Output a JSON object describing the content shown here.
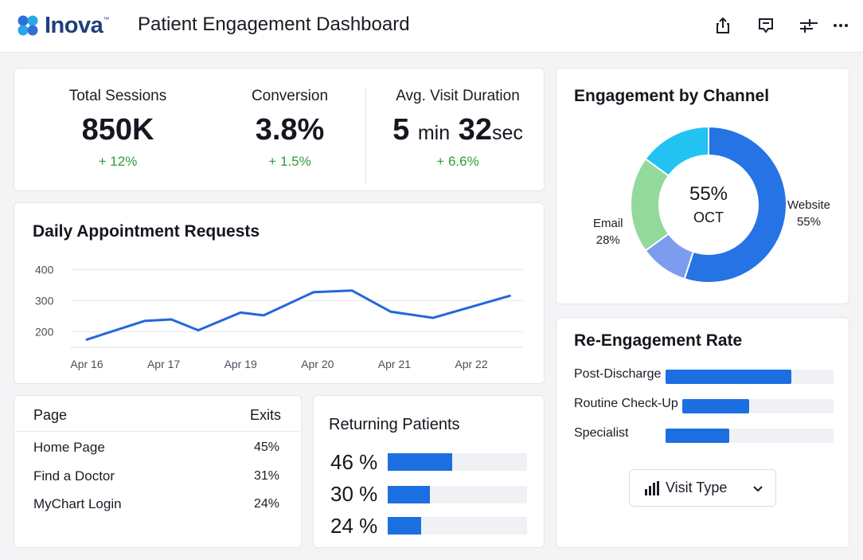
{
  "header": {
    "logo_text": "Inova",
    "logo_tm": "™",
    "title": "Patient Engagement Dashboard",
    "icons": [
      "share-icon",
      "comment-icon",
      "filter-settings-icon",
      "more-icon"
    ]
  },
  "kpis": {
    "sessions": {
      "label": "Total Sessions",
      "value": "850K",
      "delta": "+ 12%"
    },
    "conversion": {
      "label": "Conversion",
      "value": "3.8%",
      "delta": "+ 1.5%"
    },
    "duration": {
      "label": "Avg. Visit Duration",
      "min": "5",
      "min_unit": "min",
      "sec": "32",
      "sec_unit": "sec",
      "delta": "+ 6.6%"
    }
  },
  "channel": {
    "title": "Engagement by Channel",
    "center_value": "55%",
    "center_label": "OCT",
    "labels": {
      "website": {
        "name": "Website",
        "pct": "55%"
      },
      "email": {
        "name": "Email",
        "pct": "28%"
      }
    }
  },
  "daily": {
    "title": "Daily Appointment Requests"
  },
  "exits_table": {
    "headers": [
      "Page",
      "Exits"
    ],
    "rows": [
      {
        "page": "Home Page",
        "exits": "45%"
      },
      {
        "page": "Find a Doctor",
        "exits": "31%"
      },
      {
        "page": "MyChart Login",
        "exits": "24%"
      }
    ]
  },
  "returning": {
    "title": "Returning Patients",
    "rows": [
      {
        "label": "46 %",
        "value": 0.46
      },
      {
        "label": "30 %",
        "value": 0.3
      },
      {
        "label": "24 %",
        "value": 0.24
      }
    ]
  },
  "reengagement": {
    "title": "Re-Engagement Rate",
    "rows": [
      {
        "label": "Post-Discharge",
        "value": 0.75
      },
      {
        "label": "Routine Check-Up",
        "value": 0.44
      },
      {
        "label": "Specialist",
        "value": 0.38
      }
    ],
    "dropdown_label": "Visit Type"
  },
  "colors": {
    "accent": "#1c6fe0",
    "positive": "#2d9d3a",
    "brand": "#1f3e7c",
    "website": "#2673e6",
    "mobile": "#7c9cef",
    "email": "#92d99b",
    "other": "#22c2f2"
  },
  "chart_data": [
    {
      "type": "line",
      "title": "Daily Appointment Requests",
      "x_ticks": [
        "Apr 16",
        "Apr 17",
        "Apr 19",
        "Apr 20",
        "Apr 21",
        "Apr 22"
      ],
      "y_ticks": [
        "200",
        "300",
        "400"
      ],
      "ylim": [
        150,
        430
      ],
      "grid": true,
      "series": [
        {
          "values": [
            {
              "x": 0.0,
              "y": 175
            },
            {
              "x": 0.75,
              "y": 235
            },
            {
              "x": 1.1,
              "y": 240
            },
            {
              "x": 1.45,
              "y": 205
            },
            {
              "x": 2.0,
              "y": 262
            },
            {
              "x": 2.3,
              "y": 253
            },
            {
              "x": 2.95,
              "y": 328
            },
            {
              "x": 3.45,
              "y": 333
            },
            {
              "x": 3.95,
              "y": 265
            },
            {
              "x": 4.5,
              "y": 245
            },
            {
              "x": 5.5,
              "y": 316
            }
          ]
        }
      ]
    },
    {
      "type": "pie",
      "title": "Engagement by Channel",
      "slices": [
        {
          "name": "Website",
          "value": 55
        },
        {
          "value": 10
        },
        {
          "name": "Email",
          "value": 20
        },
        {
          "value": 15
        }
      ]
    }
  ]
}
